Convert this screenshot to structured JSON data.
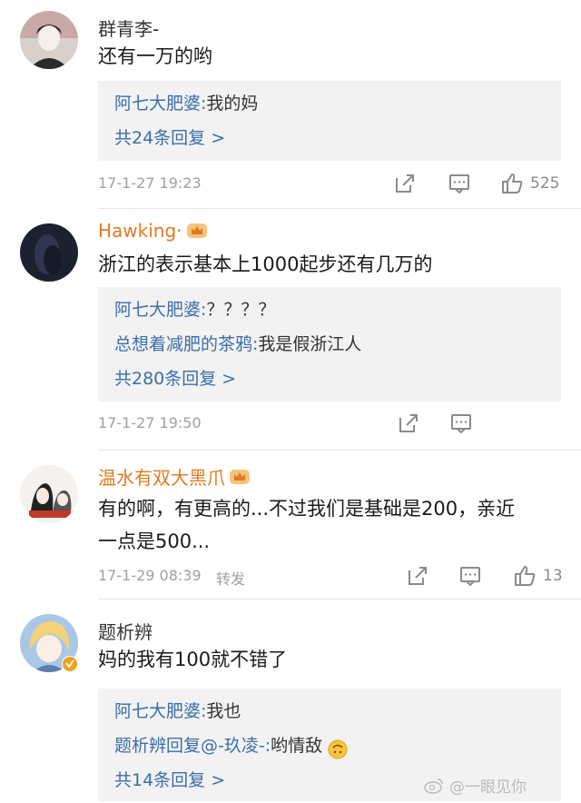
{
  "comments": [
    {
      "user": "群青李-",
      "text": "还有一万的哟",
      "replies": [
        {
          "name": "阿七大肥婆:",
          "text": "我的妈"
        }
      ],
      "more": "共24条回复 >",
      "time": "17-1-27 19:23",
      "forward": "",
      "likes": "525"
    },
    {
      "user": "Hawking·",
      "text": "浙江的表示基本上1000起步还有几万的",
      "replies": [
        {
          "name": "阿七大肥婆:",
          "text": "？？？？"
        },
        {
          "name": "总想着减肥的茶鸦:",
          "text": "我是假浙江人"
        }
      ],
      "more": "共280条回复 >",
      "time": "17-1-27 19:50",
      "forward": "",
      "likes": ""
    },
    {
      "user": "温水有双大黑爪",
      "text_line1": "有的啊，有更高的...不过我们是基础是200，亲近",
      "text_line2": "一点是500...",
      "time": "17-1-29 08:39",
      "forward": "转发",
      "likes": "13"
    },
    {
      "user": "题析辨",
      "text": "妈的我有100就不错了",
      "replies": [
        {
          "name": "阿七大肥婆:",
          "text": "我也"
        },
        {
          "name": "题析辨回复@-玖凌-:",
          "text": "哟情敌"
        }
      ],
      "more": "共14条回复 >"
    }
  ],
  "watermark": "@一眼见你",
  "icons": [
    "share-icon",
    "comment-icon",
    "like-icon",
    "crown-icon",
    "verified-icon"
  ],
  "colors": {
    "link": "#3d6ea8",
    "gold_user": "#e07b20",
    "meta": "#a0a0a0",
    "reply_bg": "#f2f2f2"
  }
}
